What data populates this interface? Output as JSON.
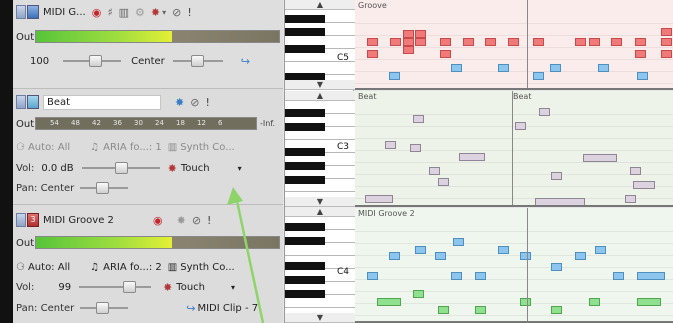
{
  "track1": {
    "name": "MIDI G...",
    "out_label": "Out",
    "volume_value": "100",
    "pan_value": "Center"
  },
  "track2": {
    "name": "Beat",
    "out_label": "Out",
    "meter_ticks": [
      "54",
      "48",
      "42",
      "36",
      "30",
      "24",
      "18",
      "12",
      "6"
    ],
    "meter_end": "-Inf.",
    "auto_label": "Auto: All",
    "instrument_label": "ARIA fo...: 1",
    "synth_label": "Synth Co...",
    "vol_label": "Vol:",
    "vol_value": "0.0 dB",
    "touch_label": "Touch",
    "pan_label": "Pan: Center"
  },
  "track3": {
    "number": "3",
    "name": "MIDI Groove 2",
    "out_label": "Out",
    "auto_label": "Auto: All",
    "instrument_label": "ARIA fo...: 2",
    "synth_label": "Synth Co...",
    "vol_label": "Vol:",
    "vol_value": "99",
    "touch_label": "Touch",
    "pan_label": "Pan: Center",
    "output_label": "MIDI Clip - 7"
  },
  "keyboard": {
    "c5": "C5",
    "c3": "C3",
    "c4": "C4"
  },
  "lanes": {
    "lane1": "Groove",
    "lane2": "Beat",
    "lane2b": "Beat",
    "lane3": "MIDI Groove 2"
  },
  "colors": {
    "meter_green": "#66cc33",
    "meter_yellow": "#ffff33",
    "red_note": "#f07a7a",
    "blue_note": "#7fbfe8",
    "grey_note": "#d8cfdc",
    "green_note": "#8fe08f",
    "annotation_arrow": "#8fd46a"
  }
}
